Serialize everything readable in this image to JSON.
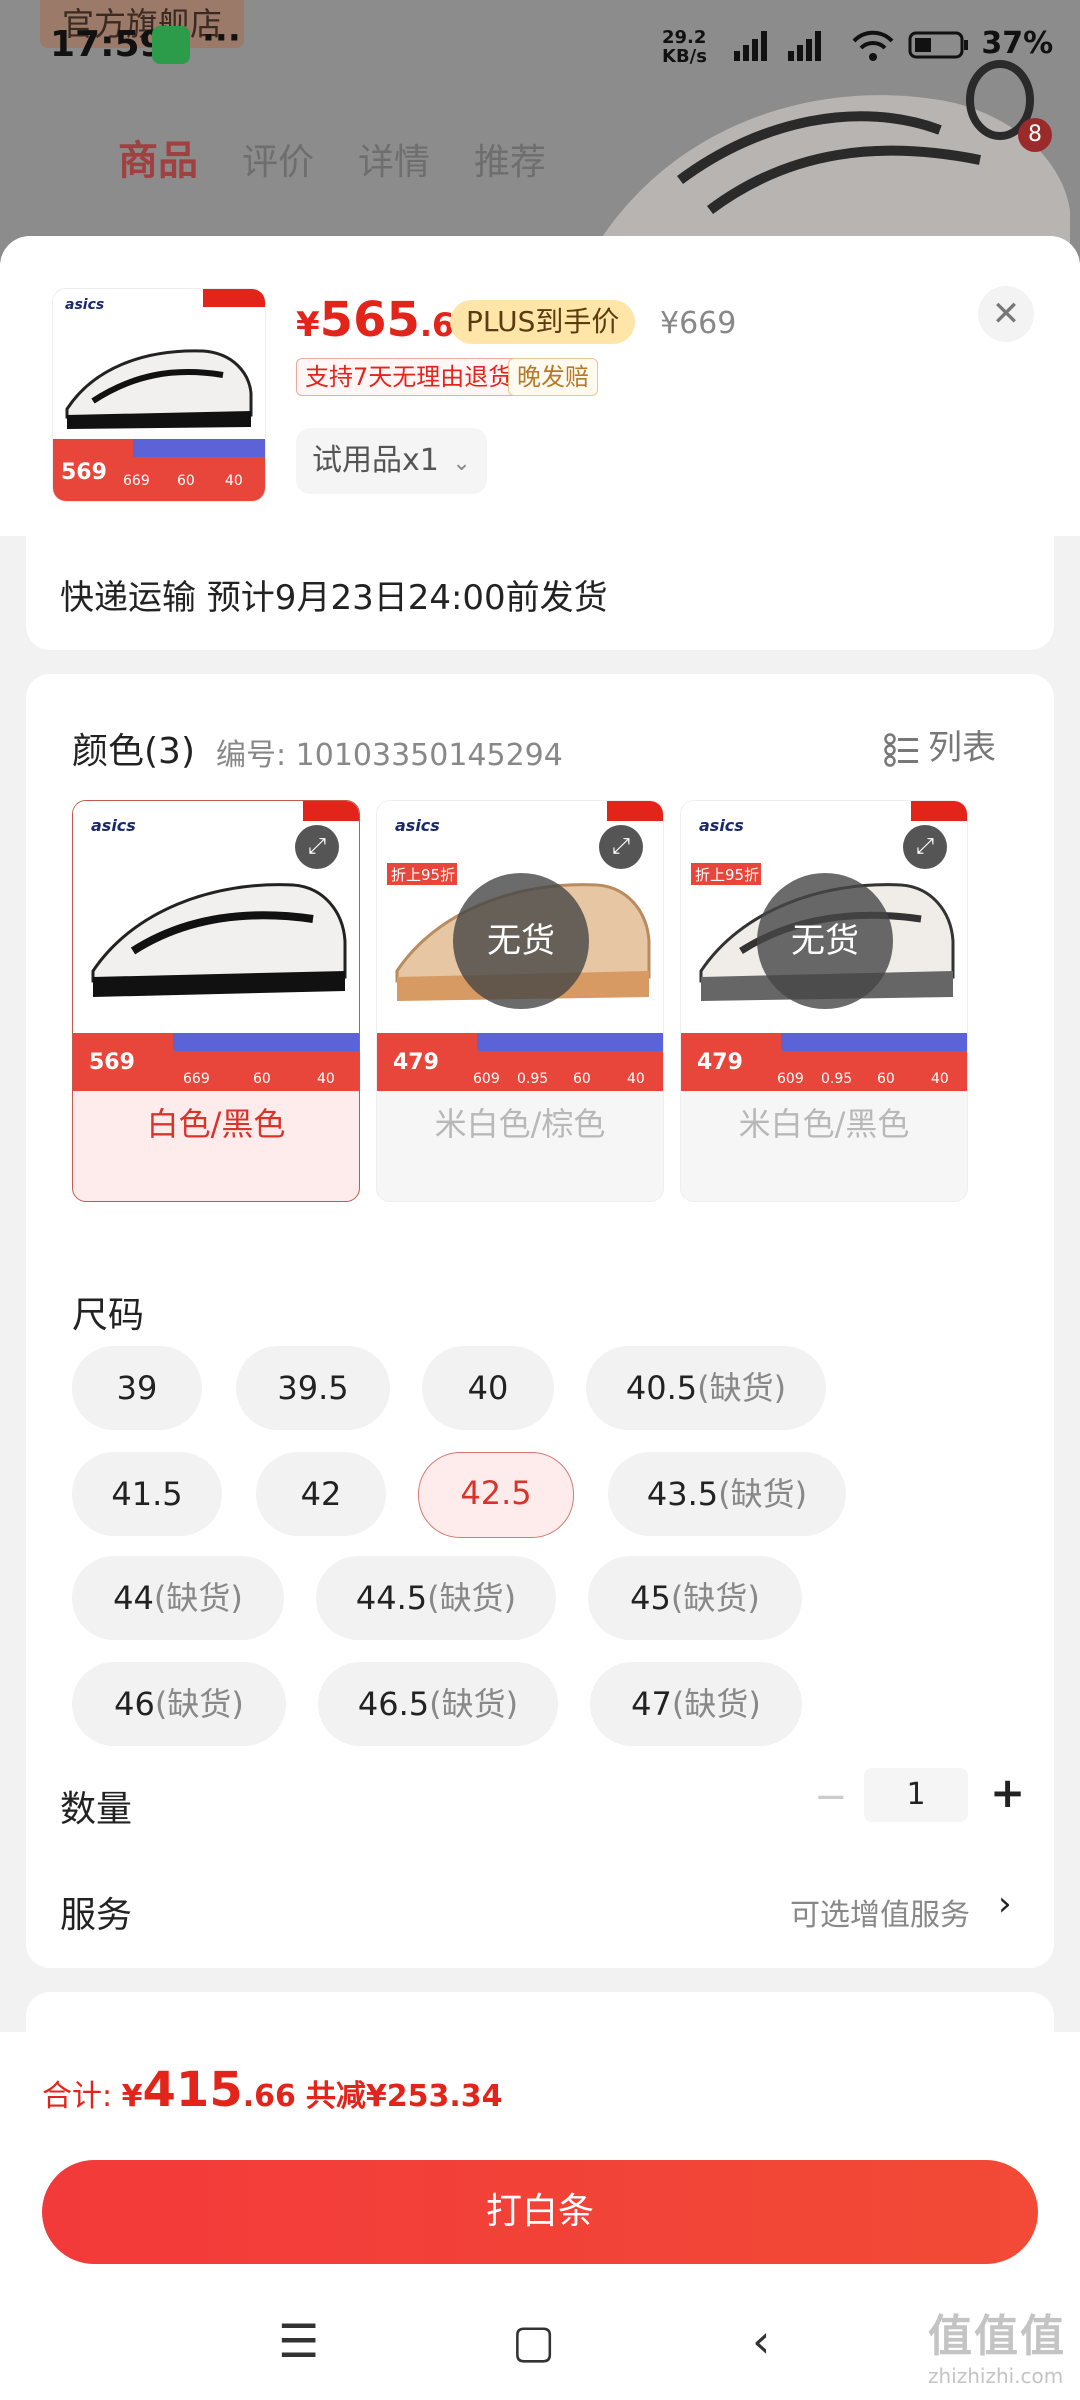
{
  "status_bar": {
    "time": "17:59",
    "net_speed_value": "29.2",
    "net_speed_unit": "KB/s",
    "battery": "37%"
  },
  "background_page": {
    "shop_tag": "官方旗舰店",
    "tabs": [
      "商品",
      "评价",
      "详情",
      "推荐"
    ],
    "cart_badge": "8"
  },
  "header": {
    "price_symbol": "¥",
    "price_int": "565",
    "price_dec": ".66",
    "plus_tag": "PLUS到手价",
    "original_price": "¥669",
    "close_icon": "close-icon",
    "tags": [
      "支持7天无理由退货",
      "晚发赔"
    ],
    "trial_selector": "试用品x1"
  },
  "thumbnail": {
    "brand": "asics",
    "price": "569",
    "cells": [
      "669",
      "60",
      "40"
    ]
  },
  "shipping": {
    "text": "快递运输 预计9月23日24:00前发货"
  },
  "color_section": {
    "title": "颜色(3)",
    "sku": "编号: 10103350145294",
    "list_label": "列表",
    "options": [
      {
        "label": "白色/黑色",
        "brand": "asics",
        "price": "569",
        "cells": [
          "669",
          "60",
          "40"
        ],
        "badge": "",
        "no_stock": "",
        "selected": true
      },
      {
        "label": "米白色/棕色",
        "brand": "asics",
        "price": "479",
        "cells": [
          "609",
          "0.95",
          "60",
          "40"
        ],
        "badge": "折上95折",
        "no_stock": "无货",
        "selected": false
      },
      {
        "label": "米白色/黑色",
        "brand": "asics",
        "price": "479",
        "cells": [
          "609",
          "0.95",
          "60",
          "40"
        ],
        "badge": "折上95折",
        "no_stock": "无货",
        "selected": false
      }
    ]
  },
  "size_section": {
    "title": "尺码",
    "sizes": [
      {
        "size": "39",
        "note": ""
      },
      {
        "size": "39.5",
        "note": ""
      },
      {
        "size": "40",
        "note": ""
      },
      {
        "size": "40.5",
        "note": "(缺货)"
      },
      {
        "size": "41.5",
        "note": ""
      },
      {
        "size": "42",
        "note": ""
      },
      {
        "size": "42.5",
        "note": ""
      },
      {
        "size": "43.5",
        "note": "(缺货)"
      },
      {
        "size": "44",
        "note": "(缺货)"
      },
      {
        "size": "44.5",
        "note": "(缺货)"
      },
      {
        "size": "45",
        "note": "(缺货)"
      },
      {
        "size": "46",
        "note": "(缺货)"
      },
      {
        "size": "46.5",
        "note": "(缺货)"
      },
      {
        "size": "47",
        "note": "(缺货)"
      }
    ],
    "selected": "42.5"
  },
  "quantity": {
    "label": "数量",
    "minus": "−",
    "value": "1",
    "plus": "+"
  },
  "service": {
    "label": "服务",
    "hint": "可选增值服务",
    "arrow": "›"
  },
  "footer": {
    "total_label": "合计: ",
    "total_symbol": "¥",
    "total_int": "415",
    "total_dec": ".66",
    "savings": "共减¥253.34",
    "pay_button": "打白条"
  },
  "nav": {
    "menu_icon": "menu-icon",
    "home_icon": "home-icon",
    "back_icon": "back-icon"
  },
  "watermark": {
    "big": "值值值",
    "small": "zhizhizhi.com"
  },
  "colors": {
    "accent_red": "#e3241b",
    "selected_bg": "#fdeceb",
    "plus_gold": "#ffe6a8"
  }
}
